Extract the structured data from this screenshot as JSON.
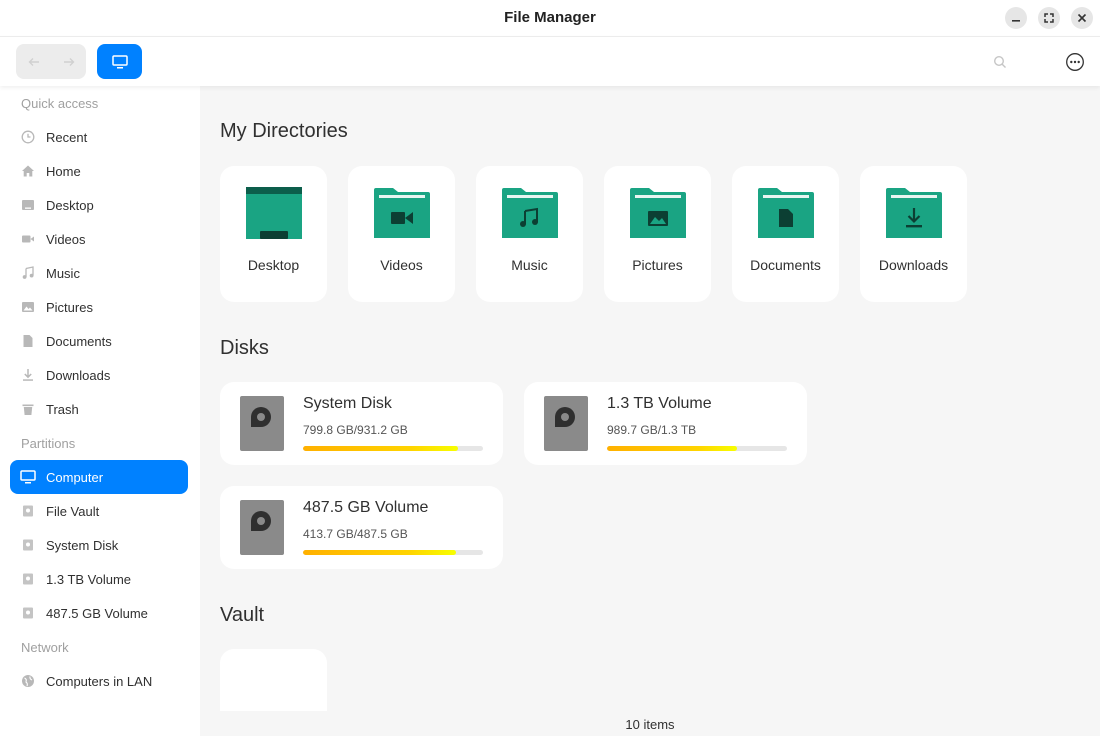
{
  "window": {
    "title": "File Manager"
  },
  "toolbar": {
    "back_icon": "arrow-left-icon",
    "forward_icon": "arrow-right-icon",
    "view_icon": "computer-icon"
  },
  "sidebar": {
    "quick_access": "Quick access",
    "partitions": "Partitions",
    "network": "Network",
    "items": [
      {
        "label": "Recent",
        "icon": "clock-icon"
      },
      {
        "label": "Home",
        "icon": "home-icon"
      },
      {
        "label": "Desktop",
        "icon": "desktop-icon"
      },
      {
        "label": "Videos",
        "icon": "video-icon"
      },
      {
        "label": "Music",
        "icon": "music-icon"
      },
      {
        "label": "Pictures",
        "icon": "picture-icon"
      },
      {
        "label": "Documents",
        "icon": "document-icon"
      },
      {
        "label": "Downloads",
        "icon": "download-icon"
      },
      {
        "label": "Trash",
        "icon": "trash-icon"
      }
    ],
    "partition_items": [
      {
        "label": "Computer",
        "icon": "computer-icon",
        "active": true
      },
      {
        "label": "File Vault",
        "icon": "disk-icon"
      },
      {
        "label": "System Disk",
        "icon": "disk-icon"
      },
      {
        "label": "1.3 TB Volume",
        "icon": "disk-icon"
      },
      {
        "label": "487.5 GB Volume",
        "icon": "disk-icon"
      }
    ],
    "network_items": [
      {
        "label": "Computers in LAN",
        "icon": "globe-icon"
      }
    ]
  },
  "main": {
    "dirs_title": "My Directories",
    "dirs": [
      {
        "label": "Desktop",
        "icon": "desktop-folder-icon"
      },
      {
        "label": "Videos",
        "icon": "video-folder-icon"
      },
      {
        "label": "Music",
        "icon": "music-folder-icon"
      },
      {
        "label": "Pictures",
        "icon": "picture-folder-icon"
      },
      {
        "label": "Documents",
        "icon": "document-folder-icon"
      },
      {
        "label": "Downloads",
        "icon": "download-folder-icon"
      }
    ],
    "disks_title": "Disks",
    "disks": [
      {
        "name": "System Disk",
        "usage": "799.8 GB/931.2 GB",
        "used_fraction": 0.859
      },
      {
        "name": "1.3 TB Volume",
        "usage": "989.7 GB/1.3 TB",
        "used_fraction": 0.72
      },
      {
        "name": "487.5 GB Volume",
        "usage": "413.7 GB/487.5 GB",
        "used_fraction": 0.849
      }
    ],
    "vault_title": "Vault",
    "status": "10 items"
  },
  "colors": {
    "accent": "#0081ff",
    "folder": "#1aa483",
    "folder_dark": "#0c5e4b",
    "disk": "#8a8a8a"
  }
}
